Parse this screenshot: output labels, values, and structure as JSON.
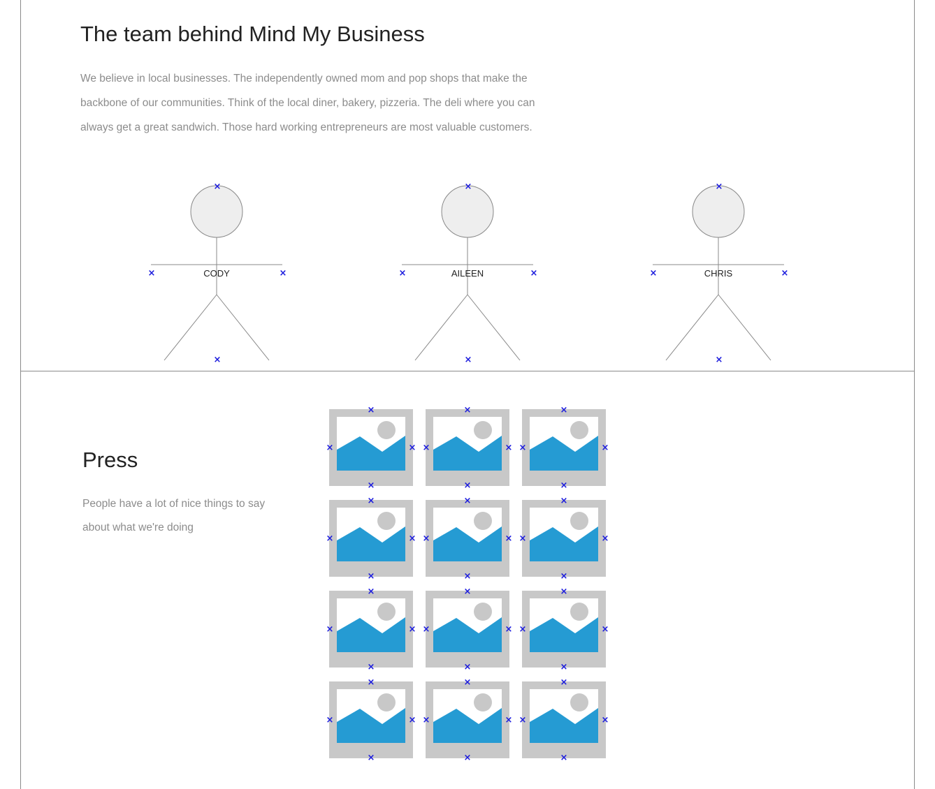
{
  "team": {
    "title": "The team behind Mind My Business",
    "description": "We believe in local businesses. The independently owned mom and pop shops that make the backbone of our communities. Think of the local diner, bakery, pizzeria. The deli where you can always get a great sandwich. Those hard working entrepreneurs are most valuable customers.",
    "members": [
      "CODY",
      "AILEEN",
      "CHRIS"
    ]
  },
  "press": {
    "title": "Press",
    "description": "People have a lot of nice things to say about what we're doing",
    "image_count": 12
  },
  "colors": {
    "placeholder_frame": "#c8c8c8",
    "placeholder_sky": "#ffffff",
    "placeholder_mountain": "#259bd3",
    "placeholder_sun": "#c8c8c8",
    "marker": "#1a1add",
    "border": "#8a8a8a"
  },
  "icons": {
    "marker": "x-marker-icon",
    "image": "image-placeholder-icon",
    "person": "stick-figure-icon"
  }
}
